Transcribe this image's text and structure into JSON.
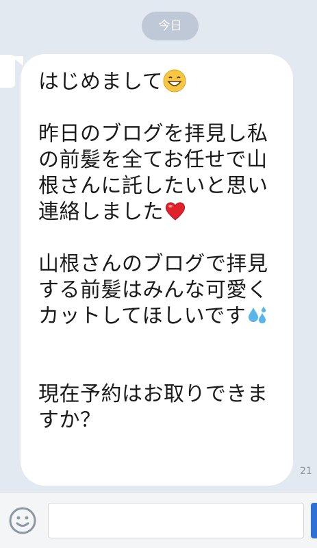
{
  "date_label": "今日",
  "message": {
    "para1": "はじめまして",
    "para2": "昨日のブログを拝見し私の前髪を全てお任せで山根さんに託したいと思い連絡しました",
    "para3": "山根さんのブログで拝見する前髪はみんな可愛くカットしてほしいです",
    "para4": "現在予約はお取りできますか？",
    "timestamp": "21"
  },
  "icons": {
    "smile_emoji": "grinning-face-emoji",
    "heart_emoji": "red-heart-emoji",
    "sweat_emoji": "sweat-droplets-emoji",
    "input_emoji_button": "smiley-icon"
  },
  "input": {
    "value": "",
    "placeholder": ""
  },
  "colors": {
    "background": "#e3e9f1",
    "bubble": "#ffffff",
    "date_pill": "#bfc8d6",
    "send_accent": "#2f6fd6"
  }
}
